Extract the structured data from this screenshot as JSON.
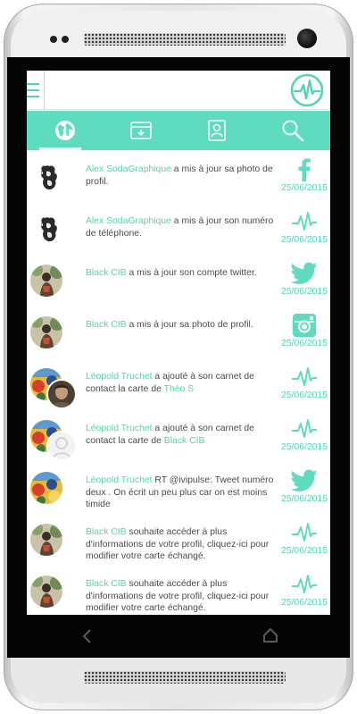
{
  "colors": {
    "accent": "#5fdcbf",
    "accent_text": "#4ed4b4",
    "text": "#4b4b4b"
  },
  "header": {
    "menu_icon": "menu-icon",
    "logo_icon": "pulse-logo-icon"
  },
  "tabs": [
    {
      "icon": "globe-icon",
      "active": true
    },
    {
      "icon": "inbox-download-icon",
      "active": false
    },
    {
      "icon": "contact-card-icon",
      "active": false
    },
    {
      "icon": "search-icon",
      "active": false
    }
  ],
  "feed": [
    {
      "name": "Alex SodaGraphique",
      "text": " a mis à jour sa photo de profil.",
      "link": "",
      "icon": "facebook-icon",
      "date": "25/06/2015"
    },
    {
      "name": "Alex SodaGraphique",
      "text": " a mis à jour son numéro de téléphone.",
      "link": "",
      "icon": "pulse-icon",
      "date": "25/06/2015"
    },
    {
      "name": "Black CIB",
      "text": " a mis à jour son compte twitter.",
      "link": "",
      "icon": "twitter-icon",
      "date": "25/06/2015"
    },
    {
      "name": "Black CIB",
      "text": " a mis à jour sa photo de profil.",
      "link": "",
      "icon": "instagram-icon",
      "date": "25/06/2015"
    },
    {
      "name": "Léopold Truchet",
      "text": " a ajouté à son carnet de contact la carte de ",
      "link": "Théo S",
      "icon": "pulse-icon",
      "date": "25/06/2015"
    },
    {
      "name": "Léopold Truchet",
      "text": " a ajouté à son carnet de contact la carte de ",
      "link": "Black CIB",
      "icon": "pulse-icon",
      "date": "25/06/2015"
    },
    {
      "name": "Léopold Truchet",
      "text": " RT @ivipulse: Tweet numéro deux . On écrit un peu plus car on est moins timide",
      "link": "",
      "icon": "twitter-icon",
      "date": "25/06/2015"
    },
    {
      "name": "Black CIB",
      "text": " souhaite accéder à plus d'informations de votre profil, cliquez-ici pour modifier votre carte échangé.",
      "link": "",
      "icon": "pulse-icon",
      "date": "25/06/2015"
    },
    {
      "name": "Black CIB",
      "text": " souhaite accéder à plus d'informations de votre profil, cliquez-ici pour modifier votre carte échangé.",
      "link": "",
      "icon": "pulse-icon",
      "date": "25/06/2015"
    }
  ],
  "system_nav": {
    "back_icon": "back-icon",
    "home_icon": "home-icon"
  }
}
